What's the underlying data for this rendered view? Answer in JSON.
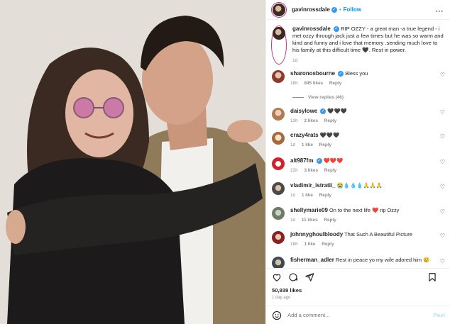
{
  "header": {
    "username": "gavinrossdale",
    "separator": "•",
    "follow_label": "Follow",
    "more_label": "..."
  },
  "caption": {
    "username": "gavinrossdale",
    "text": "RIP OZZY - a great man -a true legend - i met ozzy through jack just a few times but he was so warm and kind and funny and i love that memory .sending much love to his family at this difficult time 🖤. Rest in power.",
    "age": "1d"
  },
  "comments": [
    {
      "username": "sharonosbourne",
      "verified": true,
      "text": "Bless you",
      "age": "18h",
      "likes": "845 likes",
      "reply": "Reply",
      "view_replies": "View replies (46)"
    },
    {
      "username": "daisylowe",
      "verified": true,
      "text": "🖤🖤🖤",
      "age": "13h",
      "likes": "2 likes",
      "reply": "Reply"
    },
    {
      "username": "crazy4rats",
      "verified": false,
      "text": "🖤🖤🖤",
      "age": "1d",
      "likes": "1 like",
      "reply": "Reply"
    },
    {
      "username": "alt987fm",
      "verified": true,
      "text": "❤️❤️❤️",
      "age": "22h",
      "likes": "3 likes",
      "reply": "Reply"
    },
    {
      "username": "vladimir_istratii_",
      "verified": false,
      "text": "😭💧💧💧🙏🙏🙏",
      "age": "1d",
      "likes": "1 like",
      "reply": "Reply"
    },
    {
      "username": "shellymarie09",
      "verified": false,
      "text": "On to the next life ❤️ rip Ozzy",
      "age": "1d",
      "likes": "11 likes",
      "reply": "Reply"
    },
    {
      "username": "johnnyghoulbloody",
      "verified": false,
      "text": "That Such A Beautiful Picture",
      "age": "18h",
      "likes": "1 like",
      "reply": "Reply"
    },
    {
      "username": "fisherman_adler",
      "verified": false,
      "text": "Rest in peace yo my wife adored him 😢",
      "age": "",
      "likes": "",
      "reply": ""
    }
  ],
  "footer": {
    "likes": "50,939 likes",
    "age": "1 day ago",
    "comment_placeholder": "Add a comment...",
    "post_label": "Post"
  },
  "icons": {
    "heart": "heart-icon",
    "comment": "comment-icon",
    "share": "share-icon",
    "save": "bookmark-icon",
    "emoji": "emoji-icon",
    "more": "more-icon"
  },
  "colors": {
    "accent": "#0095f6",
    "verified": "#3897f0",
    "muted": "#8e8e8e",
    "text": "#262626"
  }
}
